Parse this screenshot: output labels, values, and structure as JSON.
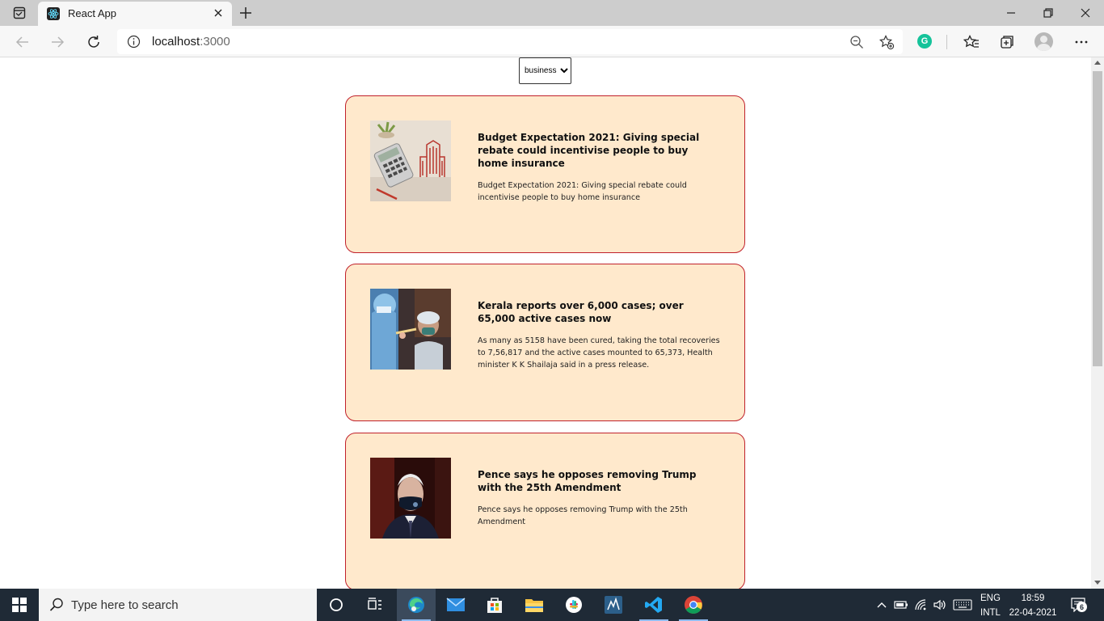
{
  "browser": {
    "tab_title": "React App",
    "url_host": "localhost",
    "url_port": ":3000"
  },
  "page": {
    "category_select": {
      "selected": "business",
      "options": [
        "business"
      ]
    },
    "articles": [
      {
        "headline": "Budget Expectation 2021: Giving special rebate could incentivise people to buy home insurance",
        "description": "Budget Expectation 2021: Giving special rebate could incentivise people to buy home insurance"
      },
      {
        "headline": "Kerala reports over 6,000 cases; over 65,000 active cases now",
        "description": "As many as 5158 have been cured, taking the total recoveries to 7,56,817 and the active cases mounted to 65,373, Health minister K K Shailaja said in a press release."
      },
      {
        "headline": "Pence says he opposes removing Trump with the 25th Amendment",
        "description": "Pence says he opposes removing Trump with the 25th Amendment"
      }
    ]
  },
  "taskbar": {
    "search_placeholder": "Type here to search",
    "lang_top": "ENG",
    "lang_bottom": "INTL",
    "time": "18:59",
    "date": "22-04-2021",
    "notifications": "6"
  },
  "colors": {
    "card_bg": "#ffe9cc",
    "card_border": "#c0212b",
    "taskbar_bg": "#1f2a36"
  }
}
